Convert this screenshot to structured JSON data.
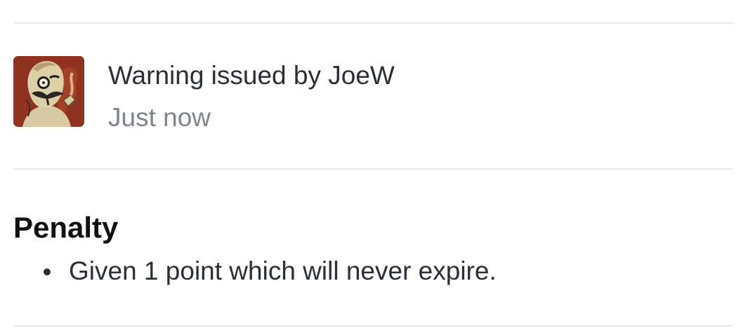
{
  "warning": {
    "issuer_text": "Warning issued by JoeW",
    "timestamp": "Just now",
    "avatar_icon": "monocle-gentleman-avatar"
  },
  "penalty": {
    "title": "Penalty",
    "items": [
      "Given 1 point which will never expire."
    ]
  },
  "colors": {
    "text_primary": "#2b2f36",
    "text_muted": "#7d8590",
    "divider": "#e6e8eb",
    "heading": "#111111",
    "avatar_background": "#8a2f1e"
  }
}
